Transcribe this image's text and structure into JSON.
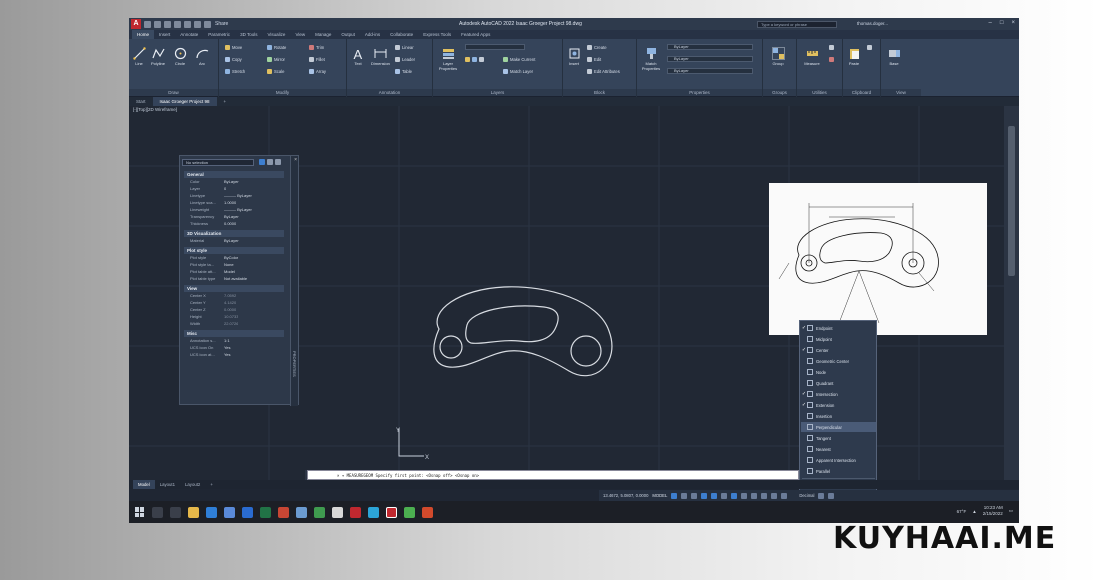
{
  "titlebar": {
    "app_letter": "A",
    "share": "Share",
    "title": "Autodesk AutoCAD 2022   Isaac Groeger Project 98.dwg",
    "search_placeholder": "Type a keyword or phrase",
    "user": "thomas.doger..."
  },
  "ribbon_tabs": [
    "Home",
    "Insert",
    "Annotate",
    "Parametric",
    "3D Tools",
    "Visualize",
    "View",
    "Manage",
    "Output",
    "Add-ins",
    "Collaborate",
    "Express Tools",
    "Featured Apps"
  ],
  "ribbon": {
    "draw": {
      "label": "Draw",
      "tools": [
        "Line",
        "Polyline",
        "Circle",
        "Arc"
      ]
    },
    "modify": {
      "label": "Modify",
      "tools": [
        "Move",
        "Rotate",
        "Trim",
        "Copy",
        "Mirror",
        "Fillet",
        "Stretch",
        "Scale",
        "Array"
      ]
    },
    "annotation": {
      "label": "Annotation",
      "tools": [
        "Text",
        "Dimension",
        "Linear",
        "Leader",
        "Table"
      ]
    },
    "layers": {
      "label": "Layers",
      "tools": [
        "Layer Properties",
        "Make Current",
        "Match Layer"
      ]
    },
    "block": {
      "label": "Block",
      "tools": [
        "Insert",
        "Create",
        "Edit",
        "Edit Attributes"
      ]
    },
    "properties": {
      "label": "Properties",
      "tools": [
        "Match Properties"
      ],
      "dropdowns": [
        "ByLayer",
        "ByLayer",
        "ByLayer"
      ]
    },
    "groups": {
      "label": "Groups",
      "tools": [
        "Group"
      ]
    },
    "utilities": {
      "label": "Utilities",
      "tools": [
        "Measure"
      ]
    },
    "clipboard": {
      "label": "Clipboard",
      "tools": [
        "Paste"
      ]
    },
    "view": {
      "label": "View",
      "tools": [
        "Base"
      ]
    }
  },
  "doc_tabs": [
    "Start",
    "Isaac Groeger Project 98"
  ],
  "viewport_label": "[-][Top][2D Wireframe]",
  "properties_palette": {
    "selector": "No selection",
    "side_label": "PROPERTIES",
    "sections": [
      {
        "name": "General",
        "rows": [
          [
            "Color",
            "ByLayer"
          ],
          [
            "Layer",
            "0"
          ],
          [
            "Linetype",
            "——— ByLayer"
          ],
          [
            "Linetype sca...",
            "1.0000"
          ],
          [
            "Lineweight",
            "——— ByLayer"
          ],
          [
            "Transparency",
            "ByLayer"
          ],
          [
            "Thickness",
            "0.0000"
          ]
        ]
      },
      {
        "name": "3D Visualization",
        "rows": [
          [
            "Material",
            "ByLayer"
          ]
        ]
      },
      {
        "name": "Plot style",
        "rows": [
          [
            "Plot style",
            "ByColor"
          ],
          [
            "Plot style ta...",
            "None"
          ],
          [
            "Plot table att...",
            "Model"
          ],
          [
            "Plot table type",
            "Not available"
          ]
        ]
      },
      {
        "name": "View",
        "rows": [
          [
            "Center X",
            "7.0592"
          ],
          [
            "Center Y",
            "4.1420"
          ],
          [
            "Center Z",
            "0.0000"
          ],
          [
            "Height",
            "10.0733"
          ],
          [
            "Width",
            "22.0726"
          ]
        ]
      },
      {
        "name": "Misc",
        "rows": [
          [
            "Annotation s...",
            "1:1"
          ],
          [
            "UCS icon On",
            "Yes"
          ],
          [
            "UCS icon at...",
            "Yes"
          ]
        ]
      }
    ]
  },
  "osnap_menu": [
    {
      "label": "Endpoint",
      "checked": true
    },
    {
      "label": "Midpoint",
      "checked": false
    },
    {
      "label": "Center",
      "checked": true
    },
    {
      "label": "Geometric Center",
      "checked": false
    },
    {
      "label": "Node",
      "checked": false
    },
    {
      "label": "Quadrant",
      "checked": false
    },
    {
      "label": "Intersection",
      "checked": true
    },
    {
      "label": "Extension",
      "checked": true
    },
    {
      "label": "Insertion",
      "checked": false
    },
    {
      "label": "Perpendicular",
      "checked": false,
      "highlighted": true
    },
    {
      "label": "Tangent",
      "checked": false
    },
    {
      "label": "Nearest",
      "checked": false
    },
    {
      "label": "Apparent Intersection",
      "checked": false
    },
    {
      "label": "Parallel",
      "checked": false
    },
    {
      "label": "Object Snap Settings...",
      "checked": false
    }
  ],
  "command_line": {
    "text": "× ▾  MEASUREGEOM Specify first point: <Osnap off> <Osnap on>"
  },
  "layout_tabs": [
    "Model",
    "Layout1",
    "Layout2",
    "+"
  ],
  "statusbar": {
    "coords": "13.4672, 5.0807, 0.0000",
    "model": "MODEL",
    "units": "Decimal"
  },
  "taskbar": {
    "weather": "67°F",
    "time": "10:23 AM",
    "date": "2/15/2022"
  },
  "ucs": {
    "x": "X",
    "y": "Y"
  },
  "watermark": "KUYHAAI.ME",
  "colors": {
    "screen_bg": "#1f2633",
    "ribbon_bg": "#35445a",
    "drawing_stroke": "#d8dce2",
    "highlight": "#4a5b77"
  }
}
